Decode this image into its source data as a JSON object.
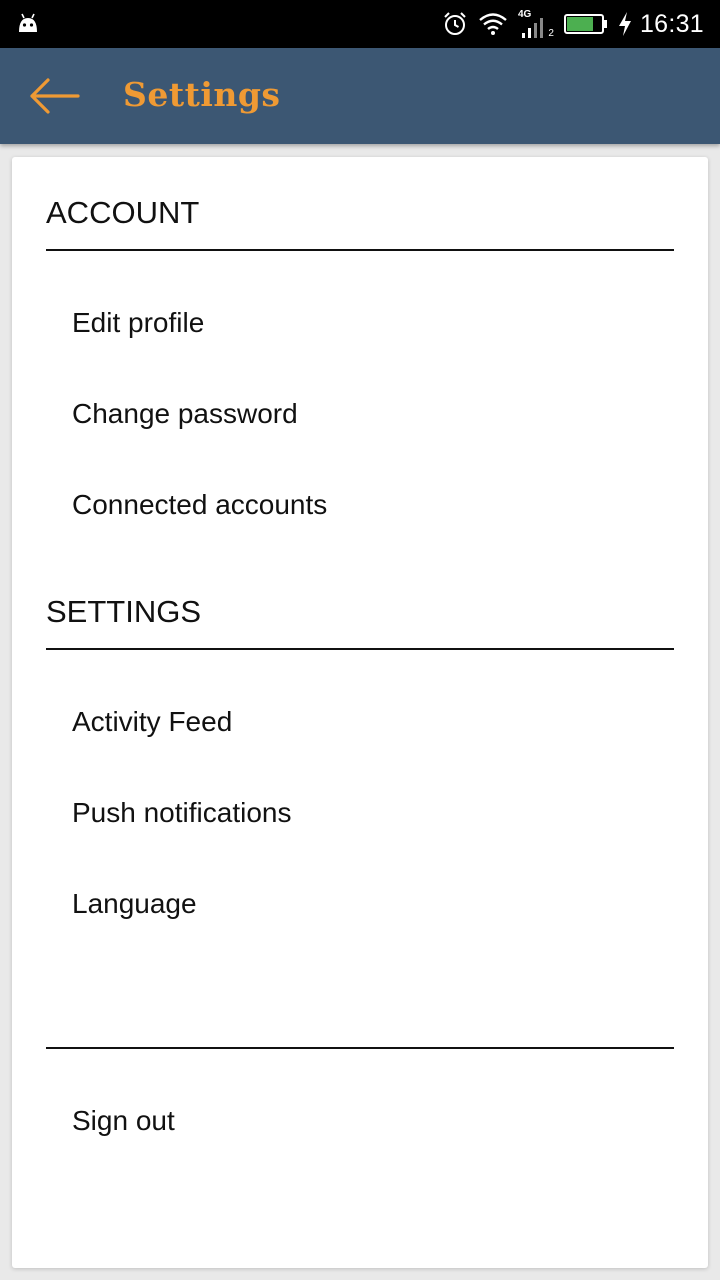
{
  "status_bar": {
    "time": "16:31",
    "network_label": "4G",
    "sim_slot": "2",
    "icons": [
      "android-notification-icon",
      "alarm-icon",
      "wifi-icon",
      "cellular-signal-icon",
      "battery-icon",
      "charging-bolt-icon"
    ],
    "battery_level": 0.75,
    "battery_color": "#4caf50"
  },
  "app_bar": {
    "title": "Settings",
    "back_icon": "arrow-left-icon",
    "background_color": "#3c5773",
    "accent_color": "#ef9a34"
  },
  "sections": [
    {
      "header": "ACCOUNT",
      "items": [
        "Edit profile",
        "Change password",
        "Connected accounts"
      ]
    },
    {
      "header": "SETTINGS",
      "items": [
        "Activity Feed",
        "Push notifications",
        "Language"
      ]
    }
  ],
  "footer": {
    "sign_out": "Sign out"
  }
}
